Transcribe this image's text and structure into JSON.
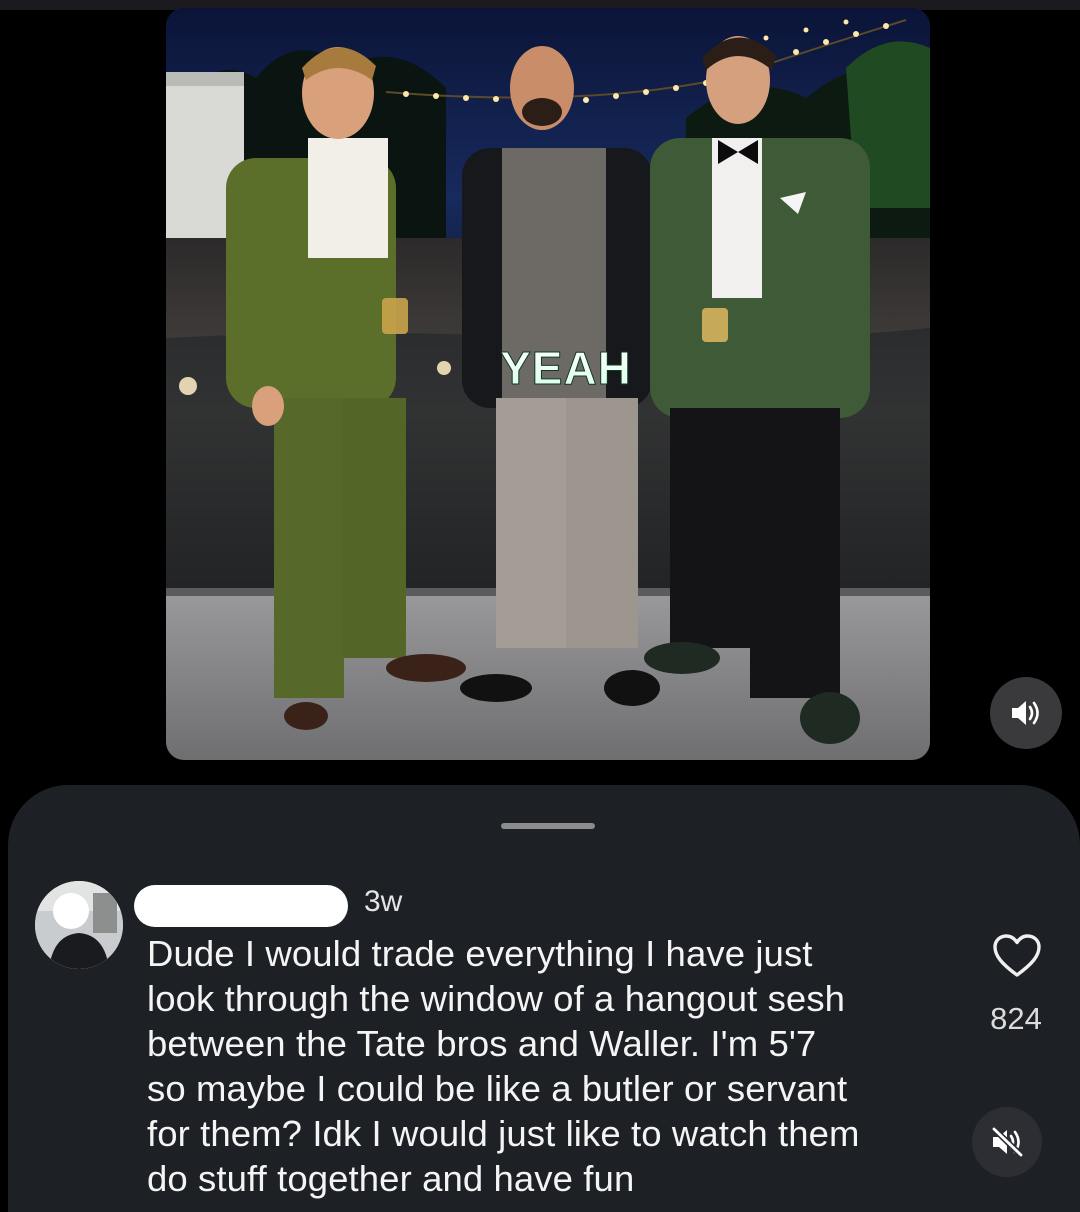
{
  "video": {
    "overlay_caption": "YEAH"
  },
  "controls": {
    "sound_icon": "speaker-on-icon",
    "mute_icon": "speaker-muted-icon"
  },
  "comment": {
    "username": "",
    "time_ago": "3w",
    "text": "Dude I would trade everything I have just\nlook through the window of a hangout sesh\nbetween the Tate bros and Waller. I'm 5'7\nso maybe I could be like a butler or servant\nfor them? Idk I would just like to watch them\ndo stuff together and have fun",
    "like_icon": "heart-outline-icon",
    "like_count": "824"
  },
  "colors": {
    "background": "#000000",
    "sheet": "#1d2024",
    "text": "#f4f4f4",
    "control_bg": "#3a3a3c"
  }
}
